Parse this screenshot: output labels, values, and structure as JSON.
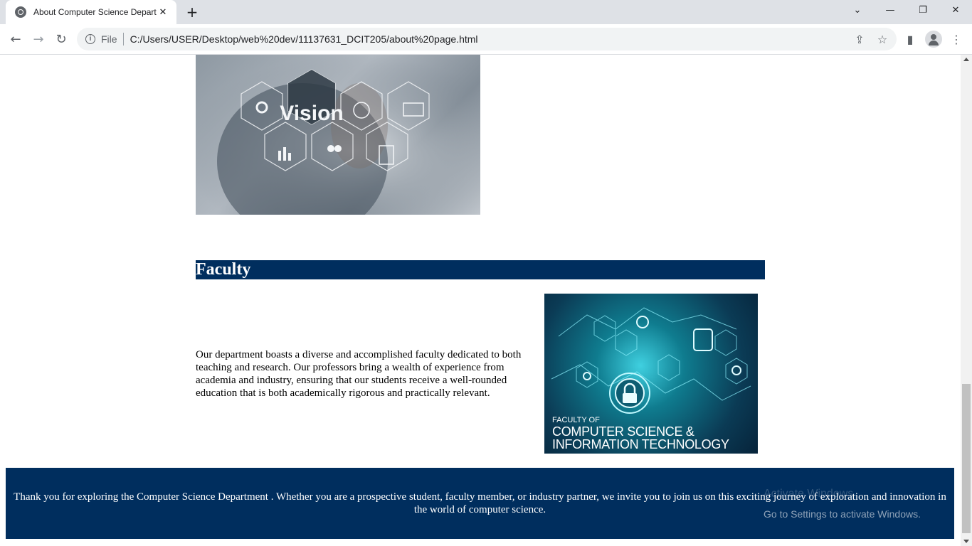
{
  "browser": {
    "tab_title": "About Computer Science Depart",
    "tab_close": "✕",
    "new_tab": "+",
    "file_label": "File",
    "url": "C:/Users/USER/Desktop/web%20dev/11137631_DCIT205/about%20page.html",
    "window_controls": {
      "dropdown": "⌄",
      "minimize": "—",
      "restore": "❐",
      "close": "✕"
    },
    "nav": {
      "back": "←",
      "forward": "→",
      "reload": "↻"
    },
    "right_icons": {
      "share": "⇪",
      "bookmark": "☆",
      "sidepanel": "▮",
      "menu": "⋮"
    }
  },
  "page": {
    "vision_image": {
      "label": "Vision",
      "icon": "vision-hexagon-icon"
    },
    "faculty_heading": "Faculty",
    "faculty_text": "Our department boasts a diverse and accomplished faculty dedicated to both teaching and research. Our professors bring a wealth of experience from academia and industry, ensuring that our students receive a well-rounded education that is both academically rigorous and practically relevant.",
    "faculty_image": {
      "small_caption": "FACULTY OF",
      "big_caption": "COMPUTER SCIENCE &\nINFORMATION TECHNOLOGY"
    },
    "footer_text": "Thank you for exploring the Computer Science Department . Whether you are a prospective student, faculty member, or industry partner, we invite you to join us on this exciting journey of exploration and innovation in the world of computer science."
  },
  "watermark": {
    "title": "Activate Windows",
    "subtitle": "Go to Settings to activate Windows."
  },
  "colors": {
    "heading_bg": "#002e5e",
    "footer_bg": "#002e5e"
  }
}
